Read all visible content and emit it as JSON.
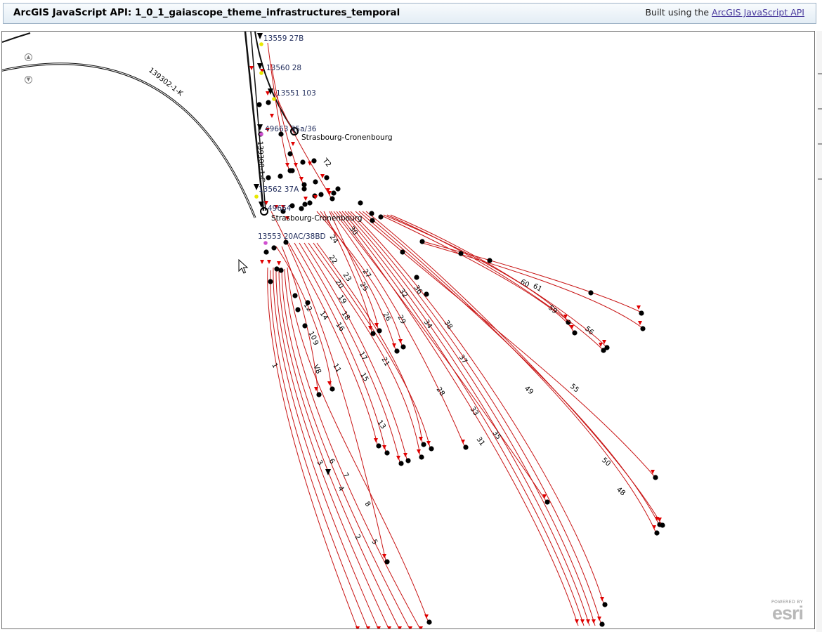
{
  "header": {
    "title": "ArcGIS JavaScript API: 1_0_1_gaiascope_theme_infrastructures_temporal",
    "credit_prefix": "Built using the",
    "credit_link": "ArcGIS JavaScript API"
  },
  "map": {
    "zoom_in_icon": "pan-up-icon",
    "zoom_out_icon": "pan-down-icon",
    "colors": {
      "track": "#c81414",
      "arrow": "#e00000",
      "endpoint": "#000000",
      "main_line": "#111111",
      "node_label": "#1e2a5a",
      "signal_yellow": "#e8e800",
      "signal_pink": "#d050d0"
    },
    "node_labels": [
      "13559 27B",
      "13560 28",
      "13551 103",
      "49663 35a/36",
      "13562 37A",
      "49664",
      "13553 20AC/38BD"
    ],
    "station_labels": [
      "Strasbourg-Cronenbourg",
      "Strasbourg-Cronenbourg"
    ],
    "line_labels": [
      "139302-1-K",
      "139300-1-C"
    ],
    "track_labels": [
      "T2",
      "30",
      "24",
      "22",
      "23",
      "20",
      "19",
      "18",
      "27",
      "25",
      "26",
      "29",
      "32",
      "36",
      "34",
      "38",
      "12",
      "14",
      "16",
      "10",
      "9",
      "V8",
      "11",
      "17",
      "21",
      "15",
      "13",
      "1",
      "3",
      "6",
      "7",
      "4",
      "8",
      "2",
      "5",
      "28",
      "37",
      "33",
      "31",
      "35",
      "49",
      "55",
      "50",
      "48",
      "60",
      "61",
      "59",
      "56"
    ],
    "attribution": {
      "powered_by": "POWERED BY",
      "logo": "esri"
    }
  }
}
